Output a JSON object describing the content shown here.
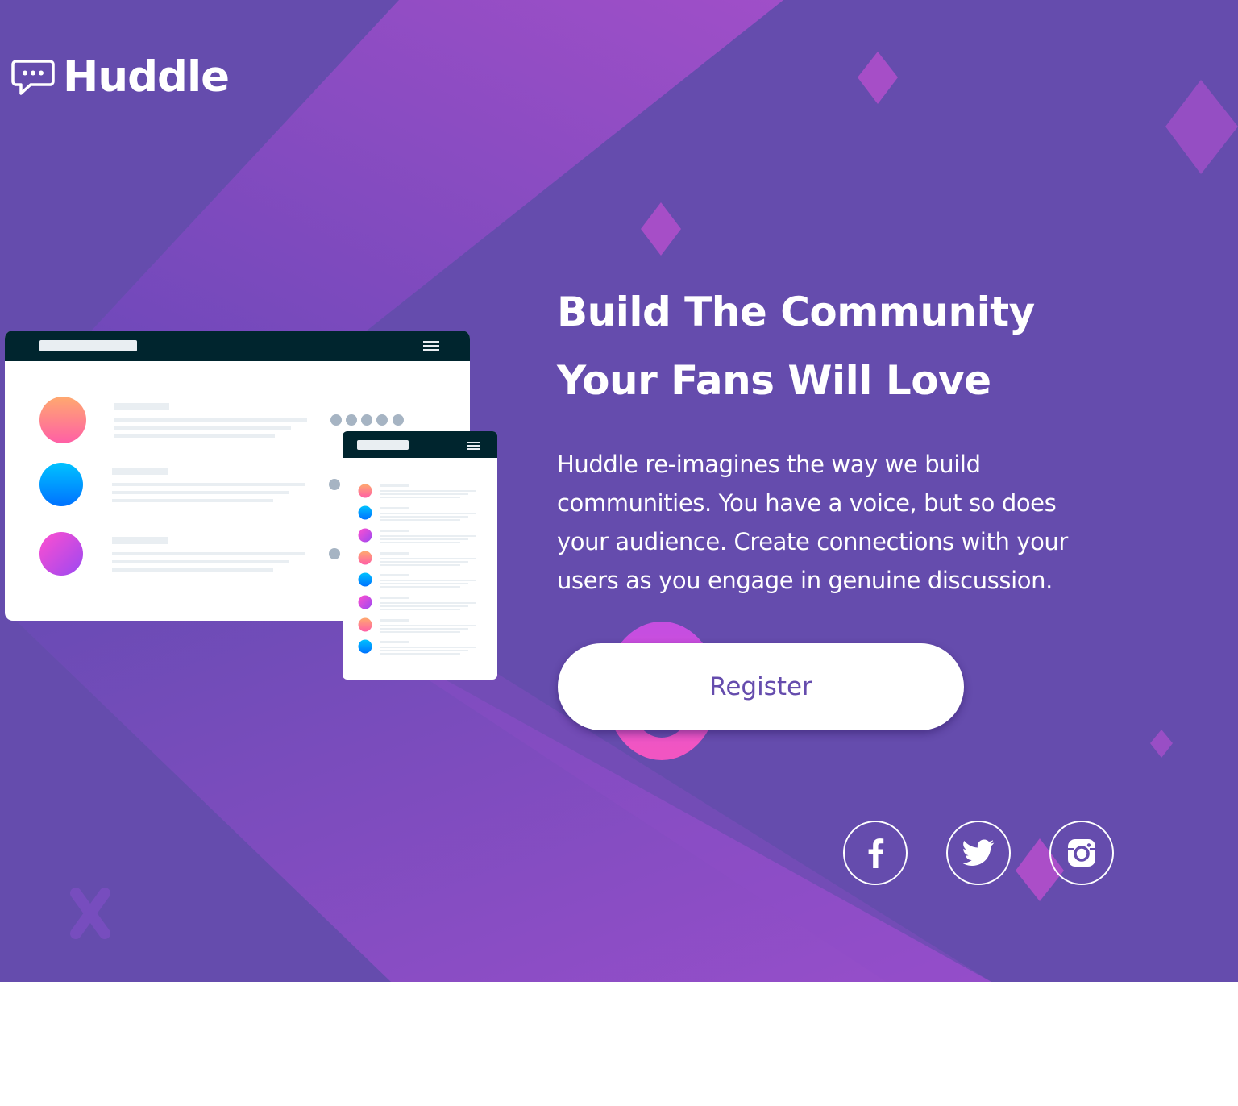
{
  "brand": {
    "name": "Huddle",
    "logo_icon": "chat-bubble-icon"
  },
  "hero": {
    "headline_line1": "Build The Community",
    "headline_line2": "Your Fans Will Love",
    "description": "Huddle re-imagines the way we build communities. You have a voice, but so does your audience. Create connections with your users as you engage in genuine discussion.",
    "cta_label": "Register"
  },
  "social": [
    {
      "name": "facebook",
      "icon": "facebook-icon"
    },
    {
      "name": "twitter",
      "icon": "twitter-icon"
    },
    {
      "name": "instagram",
      "icon": "instagram-icon"
    }
  ],
  "colors": {
    "background": "#654cad",
    "accent_pink": "#f155c2",
    "accent_purple": "#9d4bcc",
    "mockup_header": "#00252e",
    "text": "#ffffff"
  }
}
